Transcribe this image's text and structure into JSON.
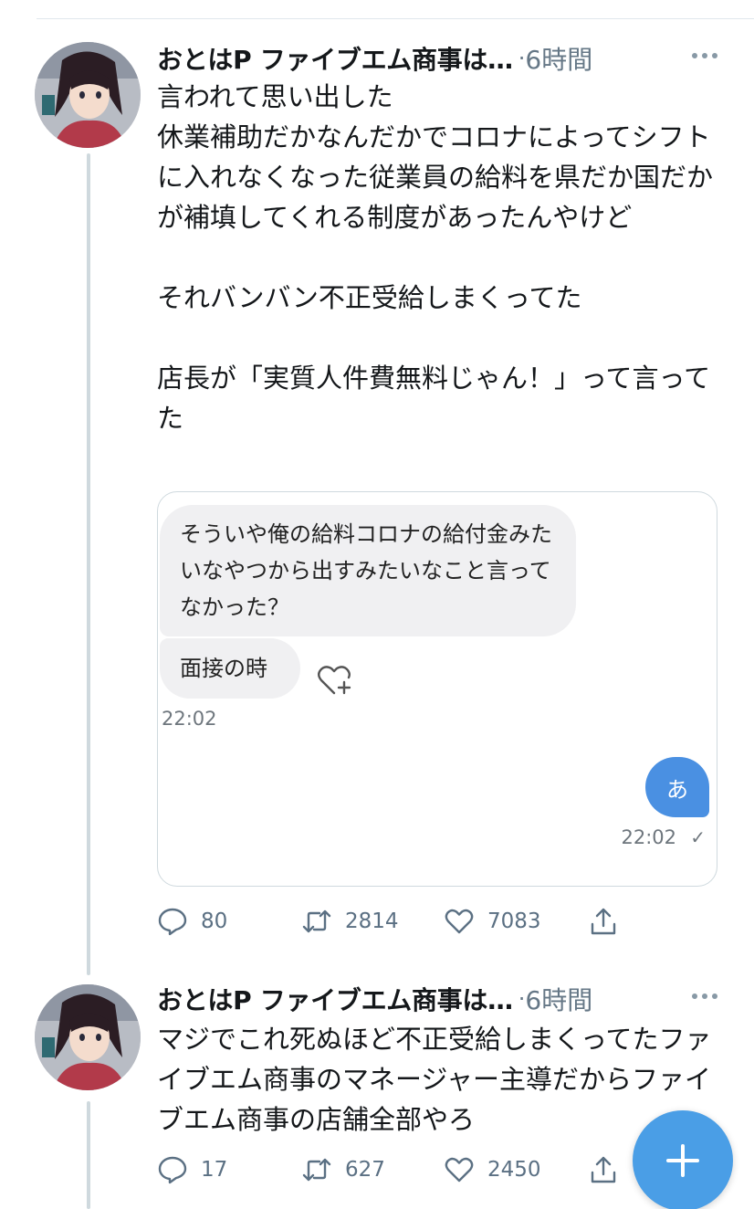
{
  "tweets": [
    {
      "author": "おとはP ファイブエム商事は…",
      "time": "6時間",
      "text": "言われて思い出した\n休業補助だかなんだかでコロナによってシフトに入れなくなった従業員の給料を県だか国だかが補填してくれる制度があったんやけど\n\nそれバンバン不正受給しまくってた\n\n店長が「実質人件費無料じゃん！」って言ってた",
      "media": {
        "bubble1": "そういや俺の給料コロナの給付金みたいなやつから出すみたいなこと言ってなかった？",
        "bubble2": "面接の時",
        "time_in": "22:02",
        "bubble_out": "あ",
        "time_out": "22:02",
        "read_mark": "✓"
      },
      "replies": "80",
      "retweets": "2814",
      "likes": "7083"
    },
    {
      "author": "おとはP ファイブエム商事は…",
      "time": "6時間",
      "text": "マジでこれ死ぬほど不正受給しまくってたファイブエム商事のマネージャー主導だからファイブエム商事の店舗全部やろ",
      "replies": "17",
      "retweets": "627",
      "likes": "2450"
    }
  ],
  "time_separator": "·",
  "compose_icon": "plus-icon",
  "colors": {
    "accent": "#4a9ee6",
    "secondary_text": "#657786",
    "bubble_out": "#4a90e2",
    "bubble_in": "#f0f0f2"
  }
}
